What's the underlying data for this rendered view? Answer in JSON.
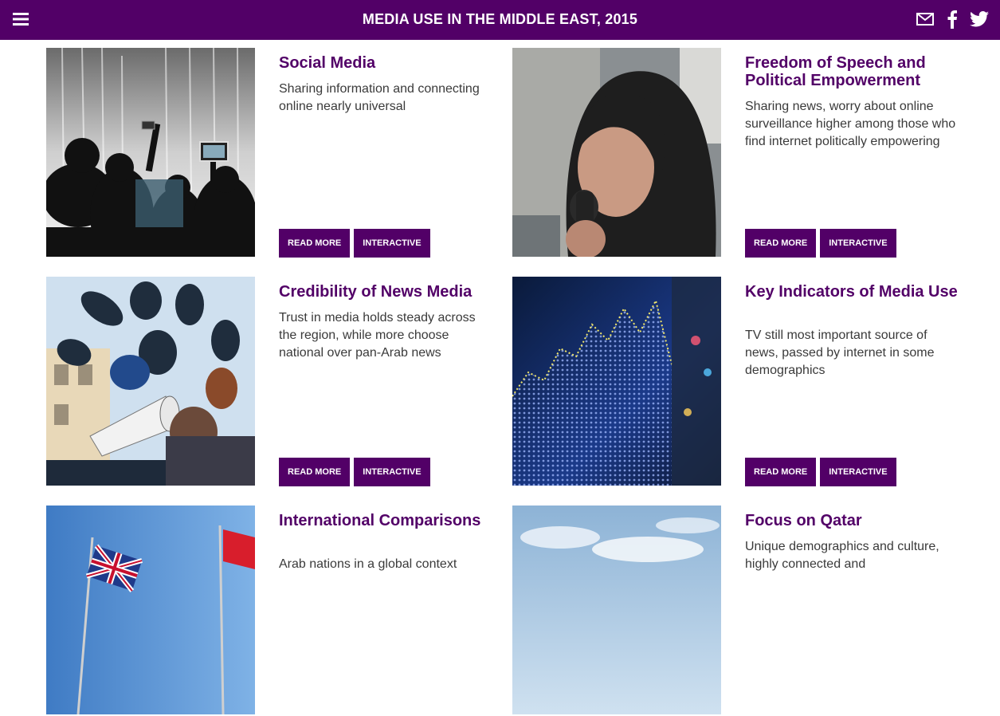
{
  "header": {
    "title": "MEDIA USE IN THE MIDDLE EAST, 2015",
    "menu_icon": "hamburger-menu-icon",
    "social_icons": [
      "email-icon",
      "facebook-icon",
      "twitter-icon"
    ],
    "bg_color": "#520067"
  },
  "cards": [
    {
      "title": "Social Media",
      "description": "Sharing information and connecting online nearly universal",
      "read_more": "READ MORE",
      "interactive": "INTERACTIVE"
    },
    {
      "title": "Freedom of Speech and Political Empowerment",
      "description": "Sharing news, worry about online surveillance higher among those who find internet politically empowering",
      "read_more": "READ MORE",
      "interactive": "INTERACTIVE"
    },
    {
      "title": "Credibility of News Media",
      "description": "Trust in media holds steady across the region, while more choose national over pan-Arab news",
      "read_more": "READ MORE",
      "interactive": "INTERACTIVE"
    },
    {
      "title": "Key Indicators of Media Use",
      "description": "TV still most important source of news, passed by internet in some demographics",
      "read_more": "READ MORE",
      "interactive": "INTERACTIVE"
    },
    {
      "title": "International Comparisons",
      "description": "Arab nations in a global context"
    },
    {
      "title": "Focus on Qatar",
      "description": "Unique demographics and culture, highly connected and"
    }
  ],
  "colors": {
    "accent": "#520067",
    "text": "#3a3a3a"
  }
}
